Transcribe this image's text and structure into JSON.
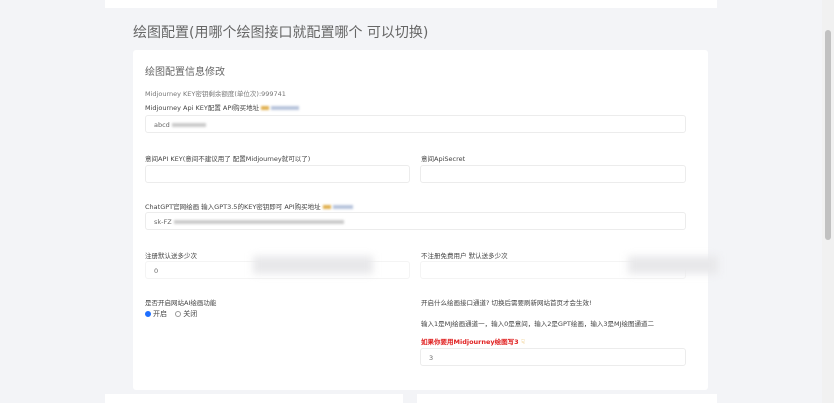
{
  "page": {
    "title": "绘图配置(用哪个绘图接口就配置哪个 可以切换)"
  },
  "card": {
    "title": "绘图配置信息修改",
    "remaining": "Midjourney KEY密钥剩余额度(单位次):999741",
    "mj_key_label": "Midjourney Api KEY配置 API购买地址",
    "mj_key_value": "abcd",
    "mp_key_label": "意间API KEY(意间不建议用了 配置Midjourney就可以了)",
    "mp_key_value": "",
    "mp_secret_label": "意间ApiSecret",
    "mp_secret_value": "",
    "gpt_label": "ChatGPT官网绘画 输入GPT3.5的KEY密钥即可 API购买地址",
    "gpt_value": "sk-FZ",
    "reg_label": "注册默认送多少次",
    "reg_value": "0",
    "unreg_label": "不注册免费用户 默认送多少次",
    "enable_label": "是否开启网站AI绘画功能",
    "enable_options": [
      {
        "label": "开启",
        "selected": true
      },
      {
        "label": "关闭",
        "selected": false
      }
    ],
    "channel_label": "开启什么绘画接口通道? 切换后需要刷新网站首页才会生效!",
    "channel_help": "输入1是MJ绘画通道一，输入0是意间，输入2是GPT绘画，输入3是MJ绘图通道二",
    "channel_hint": "如果你要用Midjourney绘图写3",
    "channel_hint_icon": "pointing-hand-icon",
    "channel_value": "3",
    "accent_color": "#1e6fff",
    "hint_color": "#e02020"
  }
}
